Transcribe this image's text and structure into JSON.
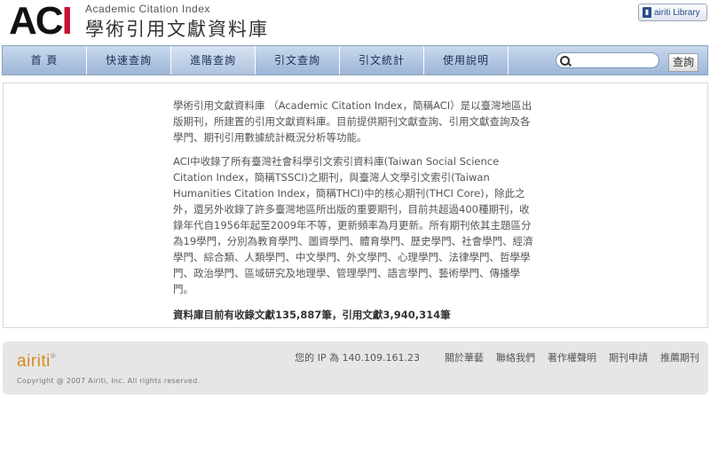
{
  "header": {
    "logo_text_black": "AC",
    "logo_text_red": "I",
    "subtitle_en": "Academic  Citation Index",
    "title_cn": "學術引用文獻資料庫",
    "library_button": "airiti Library"
  },
  "nav": {
    "items": [
      {
        "label": "首 頁"
      },
      {
        "label": "快速查詢"
      },
      {
        "label": "進階查詢"
      },
      {
        "label": "引文查詢"
      },
      {
        "label": "引文統計"
      },
      {
        "label": "使用說明"
      }
    ],
    "search_placeholder": "",
    "search_value": "",
    "search_button": "查詢"
  },
  "main": {
    "paragraph1": "學術引用文獻資料庫 （Academic Citation Index，簡稱ACI）是以臺灣地區出版期刊，所建置的引用文獻資料庫。目前提供期刊文獻查詢、引用文獻查詢及各學門、期刊引用數據統計概況分析等功能。",
    "paragraph2": "ACI中收錄了所有臺灣社會科學引文索引資料庫(Taiwan Social Science Citation Index，簡稱TSSCI)之期刊，與臺灣人文學引文索引(Taiwan Humanities Citation Index，簡稱THCI)中的核心期刊(THCI Core)，除此之外，還另外收錄了許多臺灣地區所出版的重要期刊，目前共超過400種期刊，收錄年代自1956年起至2009年不等，更新頻率為月更新。所有期刊依其主題區分為19學門，分別為教育學門、圖資學門、體育學門、歷史學門、社會學門、經濟學門、綜合類、人類學門、中文學門、外文學門、心理學門、法律學門、哲學學門、政治學門、區域研究及地理學、管理學門、語言學門、藝術學門、傳播學門。",
    "summary": "資料庫目前有收錄文獻135,887筆，引用文獻3,940,314筆"
  },
  "footer": {
    "logo": "airiti",
    "logo_mark": "®",
    "copyright": "Copyright @ 2007 Airiti, Inc. All rights reserved.",
    "ip_text": "您的 IP 為 140.109.161.23",
    "links": [
      "關於華藝",
      "聯絡我們",
      "著作權聲明",
      "期刊申請",
      "推薦期刊"
    ]
  },
  "colors": {
    "nav_top": "#c9d9ee",
    "nav_bottom": "#9db5d6",
    "footer_bg": "#e6e6e6",
    "brand_red": "#c8102e",
    "airiti_orange": "#d58a1a"
  }
}
